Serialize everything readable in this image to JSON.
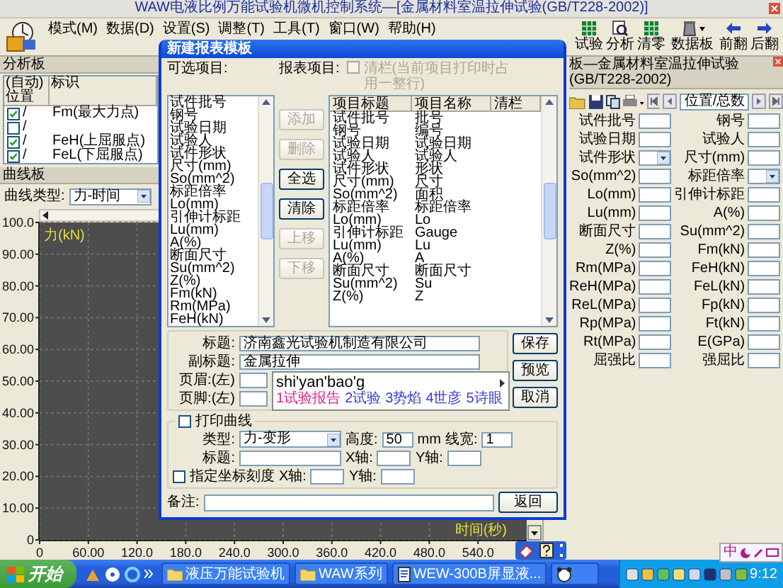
{
  "window": {
    "title": "WAW电液比例万能试验机微机控制系统—[金属材料室温拉伸试验(GB/T228-2002)]"
  },
  "menu": [
    "模式(M)",
    "数据(D)",
    "设置(S)",
    "调整(T)",
    "工具(T)",
    "窗口(W)",
    "帮助(H)"
  ],
  "toolbar": [
    "试验",
    "分析",
    "清零",
    "数据板",
    "前翻",
    "后翻"
  ],
  "analysis_panel": {
    "title": "分析板",
    "columns": [
      "(自动)位置",
      "标识"
    ],
    "rows": [
      {
        "checked": true,
        "position": "/",
        "label": "Fm(最大力点)"
      },
      {
        "checked": false,
        "position": "/"
      },
      {
        "checked": true,
        "position": "/",
        "label": "FeH(上屈服点)"
      },
      {
        "checked": true,
        "position": "/",
        "label": "FeL(下屈服点)"
      }
    ]
  },
  "curve_panel": {
    "title": "曲线板",
    "type_label": "曲线类型:",
    "type_value": "力-时间",
    "chart_data": {
      "type": "line",
      "grid": true,
      "xlabel": "时间(秒)",
      "ylabel": "力(kN)",
      "xlim": [
        0,
        600
      ],
      "ylim": [
        0,
        100
      ],
      "xticks": [
        {
          "value": 0,
          "label": "0"
        },
        {
          "value": 60,
          "label": "60.00"
        },
        {
          "value": 120,
          "label": "120.0"
        },
        {
          "value": 180,
          "label": "180.0"
        },
        {
          "value": 240,
          "label": "240.0"
        },
        {
          "value": 300,
          "label": "300.0"
        },
        {
          "value": 360,
          "label": "360.0"
        },
        {
          "value": 420,
          "label": "420.0"
        },
        {
          "value": 480,
          "label": "480.0"
        },
        {
          "value": 540,
          "label": "540.0"
        }
      ],
      "yticks": [
        {
          "value": 0,
          "label": "0"
        },
        {
          "value": 10,
          "label": "10.00"
        },
        {
          "value": 20,
          "label": "20.00"
        },
        {
          "value": 30,
          "label": "30.00"
        },
        {
          "value": 40,
          "label": "40.00"
        },
        {
          "value": 50,
          "label": "50.00"
        },
        {
          "value": 60,
          "label": "60.00"
        },
        {
          "value": 70,
          "label": "70.00"
        },
        {
          "value": 80,
          "label": "80.00"
        },
        {
          "value": 90,
          "label": "90.00"
        },
        {
          "value": 100,
          "label": "100.0"
        }
      ]
    }
  },
  "data_panel": {
    "title": "板—金属材料室温拉伸试验 (GB/T228-2002)",
    "position_label": "位置/总数",
    "fields": [
      {
        "label": "试件批号",
        "kind": "text"
      },
      {
        "label": "钢号",
        "kind": "text"
      },
      {
        "label": "试验日期",
        "kind": "text"
      },
      {
        "label": "试验人",
        "kind": "text"
      },
      {
        "label": "试件形状",
        "kind": "dropdown"
      },
      {
        "label": "尺寸(mm)",
        "kind": "text"
      },
      {
        "label": "So(mm^2)",
        "kind": "text"
      },
      {
        "label": "标距倍率",
        "kind": "dropdown"
      },
      {
        "label": "Lo(mm)",
        "kind": "text"
      },
      {
        "label": "引伸计标距",
        "kind": "text"
      },
      {
        "label": "Lu(mm)",
        "kind": "text"
      },
      {
        "label": "A(%)",
        "kind": "text"
      },
      {
        "label": "断面尺寸",
        "kind": "text"
      },
      {
        "label": "Su(mm^2)",
        "kind": "text"
      },
      {
        "label": "Z(%)",
        "kind": "text"
      },
      {
        "label": "Fm(kN)",
        "kind": "text"
      },
      {
        "label": "Rm(MPa)",
        "kind": "text"
      },
      {
        "label": "FeH(kN)",
        "kind": "text"
      },
      {
        "label": "ReH(MPa)",
        "kind": "text"
      },
      {
        "label": "FeL(kN)",
        "kind": "text"
      },
      {
        "label": "ReL(MPa)",
        "kind": "text"
      },
      {
        "label": "Fp(kN)",
        "kind": "text"
      },
      {
        "label": "Rp(MPa)",
        "kind": "text"
      },
      {
        "label": "Ft(kN)",
        "kind": "text"
      },
      {
        "label": "Rt(MPa)",
        "kind": "text"
      },
      {
        "label": "E(GPa)",
        "kind": "text"
      },
      {
        "label": "屈强比",
        "kind": "text"
      },
      {
        "label": "强屈比",
        "kind": "text"
      }
    ]
  },
  "dialog": {
    "title": "新建报表模板",
    "available_label": "可选项目:",
    "available_items": [
      "试件批号",
      "钢号",
      "试验日期",
      "试验人",
      "试件形状",
      "尺寸(mm)",
      "So(mm^2)",
      "标距倍率",
      "Lo(mm)",
      "引伸计标距",
      "Lu(mm)",
      "A(%)",
      "断面尺寸",
      "Su(mm^2)",
      "Z(%)",
      "Fm(kN)",
      "Rm(MPa)",
      "FeH(kN)"
    ],
    "buttons": [
      {
        "label": "添加",
        "disabled": true
      },
      {
        "label": "删除",
        "disabled": true
      },
      {
        "label": "全选",
        "disabled": false
      },
      {
        "label": "清除",
        "disabled": false
      },
      {
        "label": "上移",
        "disabled": true
      },
      {
        "label": "下移",
        "disabled": true
      }
    ],
    "report_label": "报表项目:",
    "full_row_checkbox": {
      "label": "清栏(当前项目打印时占用一整行)",
      "checked": false,
      "disabled": true
    },
    "report_columns": [
      "项目标题",
      "项目名称",
      "清栏"
    ],
    "report_rows": [
      {
        "title": "试件批号",
        "name": "批号"
      },
      {
        "title": "钢号",
        "name": "编号"
      },
      {
        "title": "试验日期",
        "name": "试验日期"
      },
      {
        "title": "试验人",
        "name": "试验人"
      },
      {
        "title": "试件形状",
        "name": "形状"
      },
      {
        "title": "尺寸(mm)",
        "name": "尺寸"
      },
      {
        "title": "So(mm^2)",
        "name": "面积"
      },
      {
        "title": "标距倍率",
        "name": "标距倍率"
      },
      {
        "title": "Lo(mm)",
        "name": "Lo"
      },
      {
        "title": "引伸计标距",
        "name": "Gauge"
      },
      {
        "title": "Lu(mm)",
        "name": "Lu"
      },
      {
        "title": "A(%)",
        "name": "A"
      },
      {
        "title": "断面尺寸",
        "name": "断面尺寸"
      },
      {
        "title": "Su(mm^2)",
        "name": "Su"
      },
      {
        "title": "Z(%)",
        "name": "Z"
      }
    ],
    "title_label": "标题:",
    "title_value": "济南鑫光试验机制造有限公司",
    "subtitle_label": "副标题:",
    "subtitle_value": "金属拉伸",
    "header_label": "页眉:(左)",
    "footer_label": "页脚:(左)",
    "actions": [
      "保存",
      "预览",
      "取消"
    ],
    "print_curve": {
      "label": "打印曲线",
      "checked": false
    },
    "type_label": "类型:",
    "type_value": "力-变形",
    "height_label": "高度:",
    "height_value": "50",
    "height_unit": "mm",
    "line_width_label": "线宽:",
    "line_width_value": "1",
    "chart_title_label": "标题:",
    "x_axis_label": "X轴:",
    "y_axis_label": "Y轴:",
    "scale": {
      "label": "指定坐标刻度",
      "checked": false
    },
    "scale_x_label": "X轴:",
    "scale_y_label": "Y轴:",
    "remark_label": "备注:",
    "return_button": "返回"
  },
  "ime": {
    "composition": "shi'yan'bao'g",
    "candidates": [
      {
        "text": "1试验报告",
        "selected": true
      },
      {
        "text": "2试验",
        "selected": false
      },
      {
        "text": "3势焰",
        "selected": false
      },
      {
        "text": "4世彦",
        "selected": false
      },
      {
        "text": "5诗眼",
        "selected": false
      }
    ]
  },
  "ime_status": "中",
  "taskbar": {
    "start": "开始",
    "tasks": [
      {
        "kind": "folder",
        "label": "液压万能试验机"
      },
      {
        "kind": "folder",
        "label": "WAW系列"
      },
      {
        "kind": "document",
        "label": "WEW-300B屏显液..."
      },
      {
        "kind": "app"
      }
    ],
    "clock": "9:12"
  }
}
